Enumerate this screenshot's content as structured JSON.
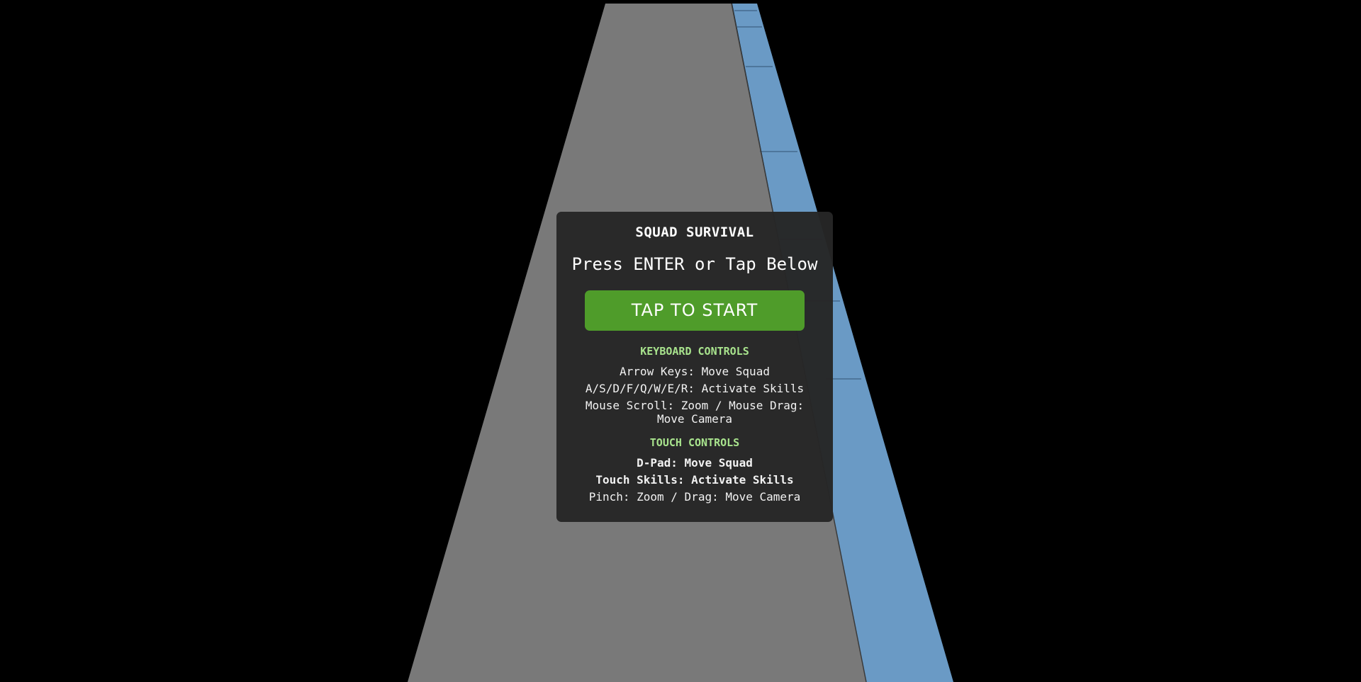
{
  "game": {
    "title": "SQUAD SURVIVAL",
    "prompt": "Press ENTER or Tap Below",
    "start_button_label": "TAP TO START",
    "keyboard": {
      "heading": "KEYBOARD CONTROLS",
      "lines": [
        "Arrow Keys: Move Squad",
        "A/S/D/F/Q/W/E/R: Activate Skills",
        "Mouse Scroll: Zoom / Mouse Drag: Move Camera"
      ]
    },
    "touch": {
      "heading": "TOUCH CONTROLS",
      "lines": [
        "D-Pad: Move Squad",
        "Touch Skills: Activate Skills",
        "Pinch: Zoom / Drag: Move Camera"
      ]
    }
  },
  "colors": {
    "background": "#000000",
    "road": "#797979",
    "water": "#6a9ac5",
    "button": "#4f9c2a",
    "heading_accent": "#a8e38d"
  }
}
